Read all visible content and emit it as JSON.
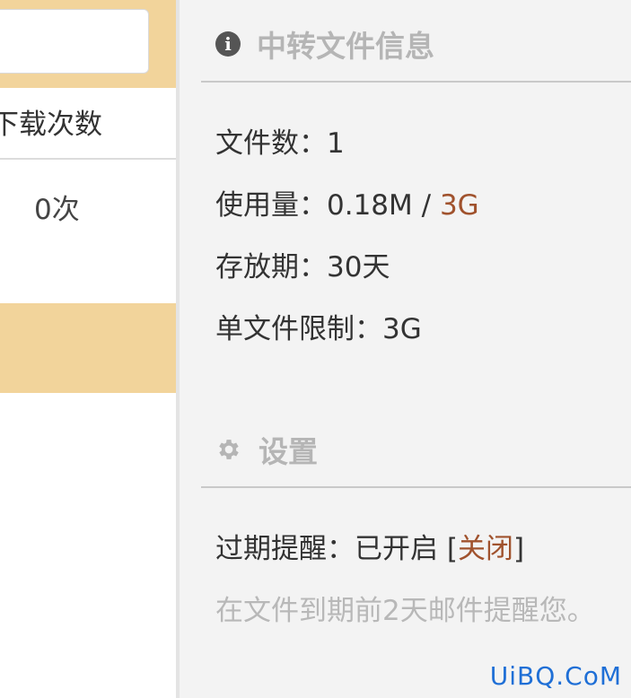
{
  "left_panel": {
    "column_header": "下载次数",
    "cell_value": "0次"
  },
  "file_info": {
    "title": "中转文件信息",
    "icon": "info-icon",
    "file_count_label": "文件数：",
    "file_count_value": "1",
    "usage_label": "使用量：",
    "usage_used": "0.18M",
    "usage_sep": " / ",
    "usage_total": "3G",
    "storage_label": "存放期：",
    "storage_value": "30天",
    "limit_label": "单文件限制：",
    "limit_value": "3G"
  },
  "settings": {
    "title": "设置",
    "icon": "gear-icon",
    "expiry_label": "过期提醒：",
    "expiry_status": "已开启",
    "bracket_open": "[",
    "close_link": "关闭",
    "bracket_close": "]",
    "hint": "在文件到期前2天邮件提醒您。"
  },
  "watermark": "UiBQ.CoM",
  "colors": {
    "accent": "#a0522d",
    "band": "#f2d49b",
    "panel_bg": "#f3f3f3",
    "hint": "#b8b8b8",
    "watermark": "#1f6fd6"
  }
}
